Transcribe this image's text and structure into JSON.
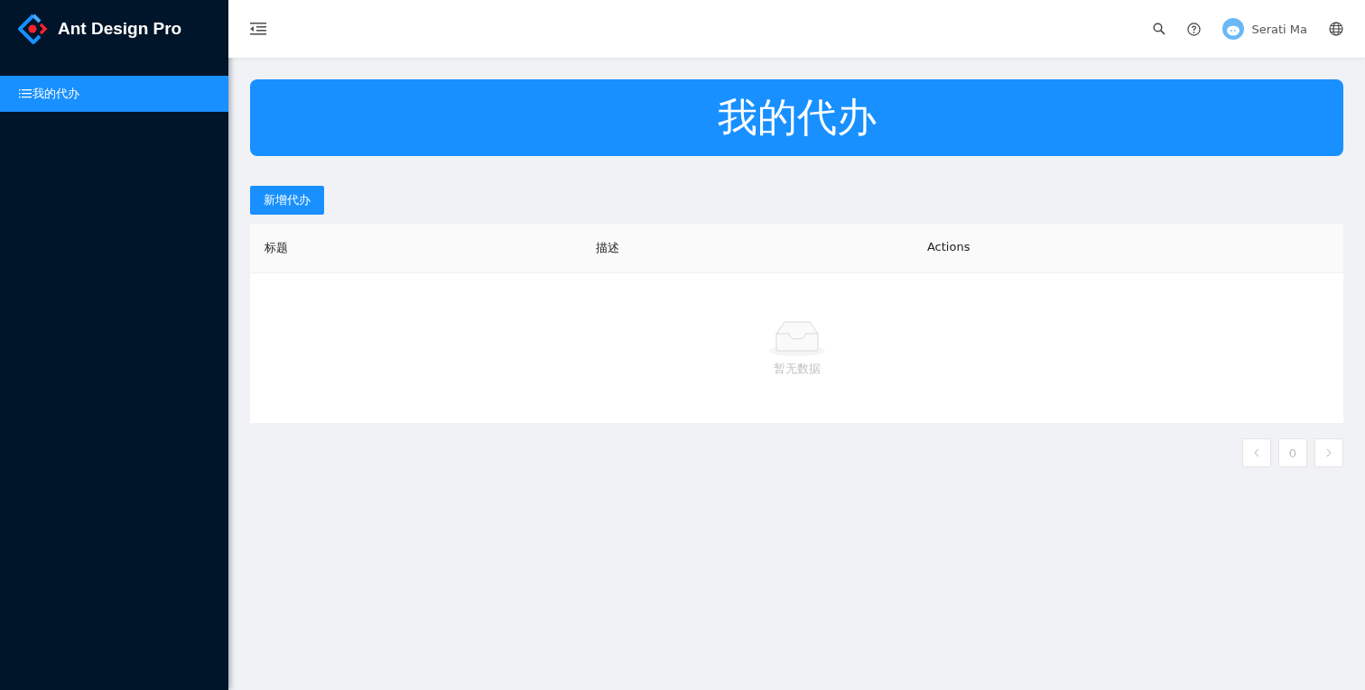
{
  "logo": {
    "title": "Ant Design Pro"
  },
  "sidebar": {
    "items": [
      {
        "label": "我的代办",
        "selected": true
      }
    ]
  },
  "header": {
    "user": "Serati Ma"
  },
  "banner": {
    "title": "我的代办"
  },
  "add_button": "新增代办",
  "table": {
    "columns": [
      "标题",
      "描述",
      "Actions"
    ],
    "empty_text": "暂无数据"
  },
  "pagination": {
    "page": "0",
    "prev_disabled": true,
    "next_disabled": true
  }
}
